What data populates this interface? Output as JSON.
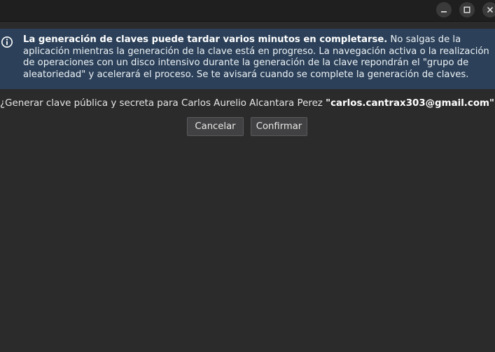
{
  "window": {
    "controls": [
      "minimize",
      "maximize",
      "close"
    ]
  },
  "info": {
    "icon": "info-icon",
    "bold": "La generación de claves puede tardar varios minutos en completarse.",
    "text": " No salgas de la aplicación mientras la generación de la clave está en progreso. La navegación activa o la realización de operaciones con un disco intensivo durante la generación de la clave repondrán el \"grupo de aleatoriedad\" y acelerará el proceso. Se te avisará cuando se complete la generación de claves."
  },
  "question": {
    "prefix": "¿Generar clave pública y secreta para Carlos Aurelio Alcantara Perez ",
    "email": "\"carlos.cantrax303@gmail.com\"",
    "suffix": "?"
  },
  "buttons": {
    "cancel": "Cancelar",
    "confirm": "Confirmar"
  }
}
